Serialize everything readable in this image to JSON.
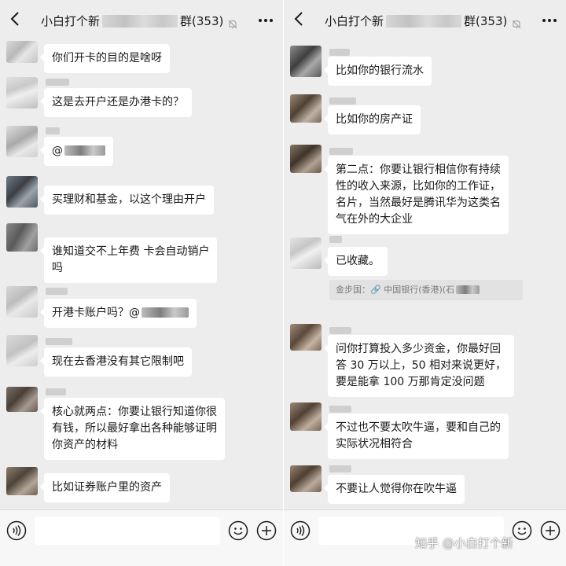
{
  "chat_title": "小白打个新",
  "chat_title_suffix": "群(353)",
  "left": {
    "messages": [
      {
        "text_lines": [
          "你们开卡的目的是啥呀"
        ]
      },
      {
        "text_lines": [
          "这是去开户还是办港卡的？"
        ]
      },
      {
        "text_lines": [
          "@"
        ]
      },
      {
        "text_lines": [
          "买理财和基金，以这个理由开户"
        ]
      },
      {
        "text_lines": [
          "谁知道交不上年费  卡会自动销户",
          "吗"
        ]
      },
      {
        "text_lines": [
          "开港卡账户吗？@"
        ]
      },
      {
        "text_lines": [
          "现在去香港没有其它限制吧"
        ]
      },
      {
        "text_lines": [
          "核心就两点：你要让银行知道你很",
          "有钱，所以最好拿出各种能够证明",
          "你资产的材料"
        ]
      },
      {
        "text_lines": [
          "比如证券账户里的资产"
        ]
      }
    ]
  },
  "right": {
    "messages": [
      {
        "text_lines": [
          "比如你的银行流水"
        ]
      },
      {
        "text_lines": [
          "比如你的房产证"
        ]
      },
      {
        "text_lines": [
          "第二点：你要让银行相信你有持续",
          "性的收入来源，比如你的工作证，",
          "名片，当然最好是腾讯华为这类名",
          "气在外的大企业"
        ]
      },
      {
        "text_lines": [
          "已收藏。"
        ],
        "quote": "金步国：🔗 中国银行(香港)(石"
      },
      {
        "text_lines": [
          "问你打算投入多少资金，你最好回",
          "答 30 万以上，50 相对来说更好，",
          "要是能拿 100 万那肯定没问题"
        ]
      },
      {
        "text_lines": [
          "不过也不要太吹牛逼，要和自己的",
          "实际状况相符合"
        ]
      },
      {
        "text_lines": [
          "不要让人觉得你在吹牛逼"
        ]
      }
    ]
  },
  "watermark": "知乎 @小白打个新",
  "icons": {
    "back": "back-arrow-icon",
    "mute": "mute-bell-icon",
    "more": "more-dots-icon",
    "voice": "voice-input-icon",
    "emoji": "emoji-icon",
    "plus": "plus-icon"
  },
  "colors": {
    "background": "#ededed",
    "bubble": "#ffffff",
    "text": "#191919",
    "input_bar": "#f7f7f7"
  }
}
